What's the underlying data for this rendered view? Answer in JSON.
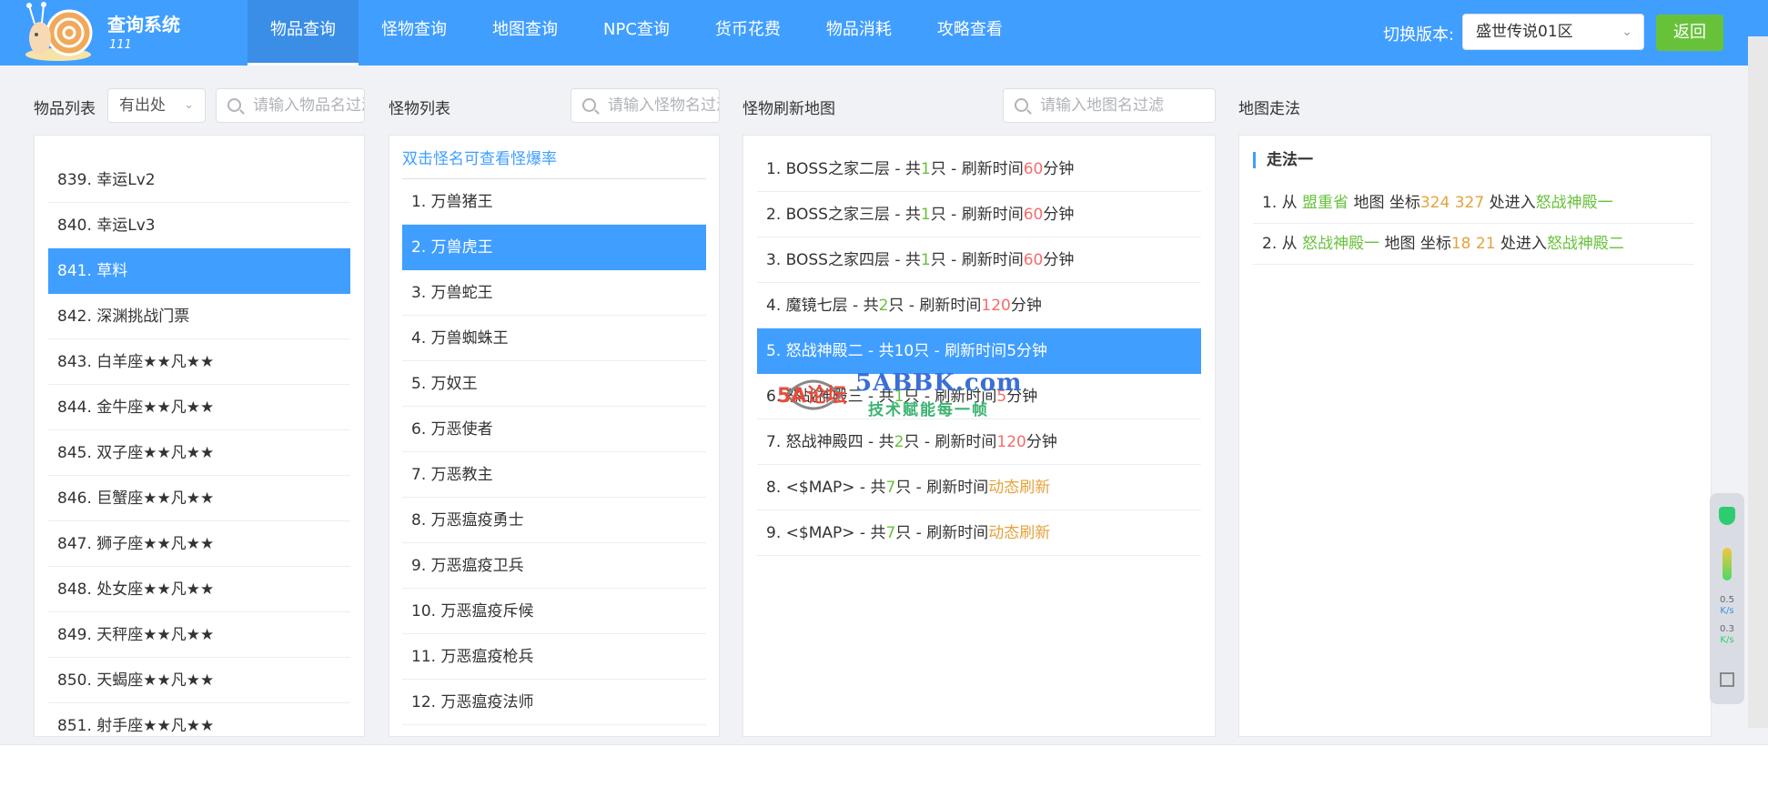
{
  "app": {
    "title": "查询系统",
    "subtitle": "111"
  },
  "nav": [
    {
      "label": "物品查询",
      "active": true
    },
    {
      "label": "怪物查询",
      "active": false
    },
    {
      "label": "地图查询",
      "active": false
    },
    {
      "label": "NPC查询",
      "active": false
    },
    {
      "label": "货币花费",
      "active": false
    },
    {
      "label": "物品消耗",
      "active": false
    },
    {
      "label": "攻略查看",
      "active": false
    }
  ],
  "version": {
    "label": "切换版本:",
    "selected": "盛世传说01区"
  },
  "back_label": "返回",
  "items_panel": {
    "label": "物品列表",
    "filter_value": "有出处",
    "search_placeholder": "请输入物品名过滤",
    "rows": [
      {
        "no": "839.",
        "name": "幸运Lv2",
        "selected": false
      },
      {
        "no": "840.",
        "name": "幸运Lv3",
        "selected": false
      },
      {
        "no": "841.",
        "name": "草料",
        "selected": true
      },
      {
        "no": "842.",
        "name": "深渊挑战门票",
        "selected": false
      },
      {
        "no": "843.",
        "name": "白羊座★★凡★★",
        "selected": false
      },
      {
        "no": "844.",
        "name": "金牛座★★凡★★",
        "selected": false
      },
      {
        "no": "845.",
        "name": "双子座★★凡★★",
        "selected": false
      },
      {
        "no": "846.",
        "name": "巨蟹座★★凡★★",
        "selected": false
      },
      {
        "no": "847.",
        "name": "狮子座★★凡★★",
        "selected": false
      },
      {
        "no": "848.",
        "name": "处女座★★凡★★",
        "selected": false
      },
      {
        "no": "849.",
        "name": "天秤座★★凡★★",
        "selected": false
      },
      {
        "no": "850.",
        "name": "天蝎座★★凡★★",
        "selected": false
      },
      {
        "no": "851.",
        "name": "射手座★★凡★★",
        "selected": false
      }
    ]
  },
  "monster_panel": {
    "label": "怪物列表",
    "search_placeholder": "请输入怪物名过滤",
    "hint": "双击怪名可查看怪爆率",
    "rows": [
      {
        "no": "1.",
        "name": "万兽猪王",
        "selected": false
      },
      {
        "no": "2.",
        "name": "万兽虎王",
        "selected": true
      },
      {
        "no": "3.",
        "name": "万兽蛇王",
        "selected": false
      },
      {
        "no": "4.",
        "name": "万兽蜘蛛王",
        "selected": false
      },
      {
        "no": "5.",
        "name": "万奴王",
        "selected": false
      },
      {
        "no": "6.",
        "name": "万恶使者",
        "selected": false
      },
      {
        "no": "7.",
        "name": "万恶教主",
        "selected": false
      },
      {
        "no": "8.",
        "name": "万恶瘟疫勇士",
        "selected": false
      },
      {
        "no": "9.",
        "name": "万恶瘟疫卫兵",
        "selected": false
      },
      {
        "no": "10.",
        "name": "万恶瘟疫斥候",
        "selected": false
      },
      {
        "no": "11.",
        "name": "万恶瘟疫枪兵",
        "selected": false
      },
      {
        "no": "12.",
        "name": "万恶瘟疫法师",
        "selected": false
      }
    ]
  },
  "map_panel": {
    "label": "怪物刷新地图",
    "search_placeholder": "请输入地图名过滤",
    "text": {
      "count_prefix": "- 共",
      "count_suffix": "只 - 刷新时间",
      "unit": "分钟"
    },
    "rows": [
      {
        "no": "1.",
        "map": "BOSS之家二层",
        "count": "1",
        "time": "60",
        "unit_shown": true,
        "time_color": "#f56c6c",
        "selected": false
      },
      {
        "no": "2.",
        "map": "BOSS之家三层",
        "count": "1",
        "time": "60",
        "unit_shown": true,
        "time_color": "#f56c6c",
        "selected": false
      },
      {
        "no": "3.",
        "map": "BOSS之家四层",
        "count": "1",
        "time": "60",
        "unit_shown": true,
        "time_color": "#f56c6c",
        "selected": false
      },
      {
        "no": "4.",
        "map": "魔镜七层",
        "count": "2",
        "time": "120",
        "unit_shown": true,
        "time_color": "#f56c6c",
        "selected": false
      },
      {
        "no": "5.",
        "map": "怒战神殿二",
        "count": "10",
        "time": "5",
        "unit_shown": true,
        "time_color": "#ffffff",
        "selected": true
      },
      {
        "no": "6.",
        "map": "怒战神殿三",
        "count": "1",
        "time": "5",
        "unit_shown": true,
        "time_color": "#f56c6c",
        "selected": false
      },
      {
        "no": "7.",
        "map": "怒战神殿四",
        "count": "2",
        "time": "120",
        "unit_shown": true,
        "time_color": "#f56c6c",
        "selected": false
      },
      {
        "no": "8.",
        "map": "<$MAP>",
        "count": "7",
        "time": "动态刷新",
        "unit_shown": false,
        "time_color": "#e6a23c",
        "selected": false
      },
      {
        "no": "9.",
        "map": "<$MAP>",
        "count": "7",
        "time": "动态刷新",
        "unit_shown": false,
        "time_color": "#e6a23c",
        "selected": false
      }
    ]
  },
  "route_panel": {
    "label": "地图走法",
    "title": "走法一",
    "text": {
      "from": "从",
      "map_word": "地图 坐标",
      "enter": "处进入"
    },
    "rows": [
      {
        "no": "1.",
        "from": "盟重省",
        "coords": "324 327",
        "to": "怒战神殿一"
      },
      {
        "no": "2.",
        "from": "怒战神殿一",
        "coords": "18 21",
        "to": "怒战神殿二"
      }
    ]
  },
  "watermark": {
    "main": "5ABBK.com",
    "sub": "技术赋能每一帧",
    "brand": "5A论坛"
  },
  "widget": {
    "up_speed": "0.5",
    "up_unit": "K/s",
    "down_speed": "0.3",
    "down_unit": "K/s"
  },
  "colors": {
    "primary": "#409eff",
    "success": "#67c23a",
    "danger": "#f56c6c",
    "warning": "#e6a23c"
  }
}
